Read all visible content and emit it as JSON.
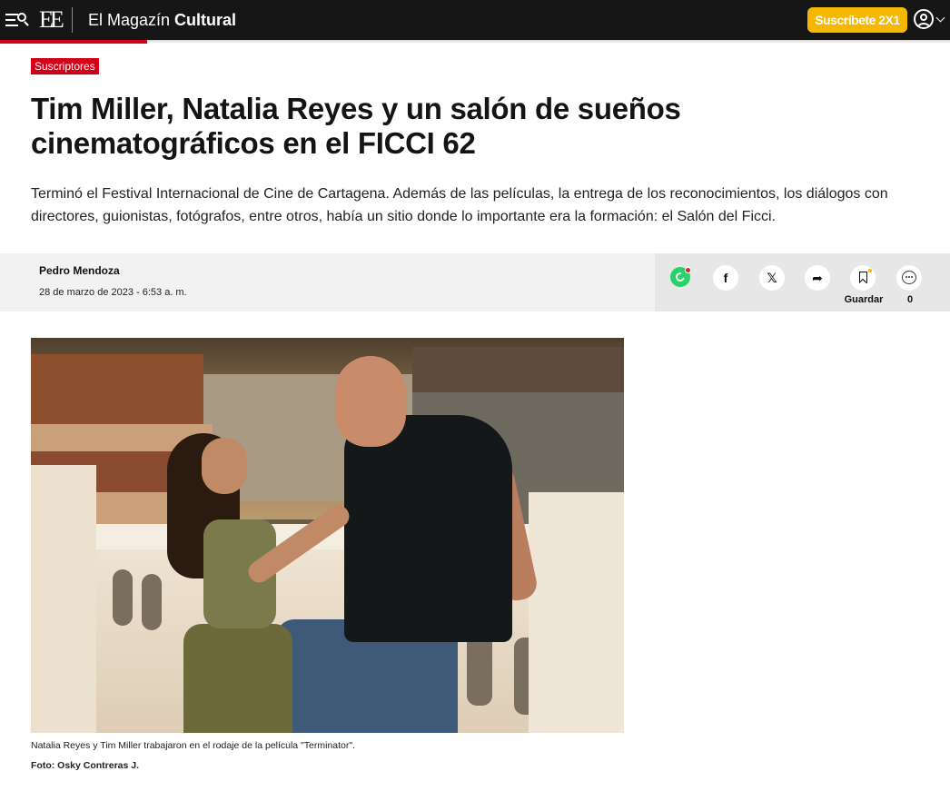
{
  "header": {
    "logo_text": "EE",
    "section_title_light": "El Magazín ",
    "section_title_bold": "Cultural",
    "subscribe_label": "Suscríbete 2X1",
    "colors": {
      "bar_bg": "#161616",
      "progress": "#d10019",
      "subscribe": "#f5b700"
    },
    "icons": {
      "menu": "menu-search-icon",
      "user": "user-circle-icon",
      "dropdown": "chevron-down-icon"
    }
  },
  "article": {
    "badge": "Suscriptores",
    "title": "Tim Miller, Natalia Reyes y un salón de sueños cinematográficos en el FICCI 62",
    "dek": "Terminó el Festival Internacional de Cine de Cartagena. Además de las películas, la entrega de los reconocimientos, los diálogos con directores, guionistas, fotógrafos, entre otros, había un sitio donde lo importante era la formación: el Salón del Ficci.",
    "author": "Pedro Mendoza",
    "date": "28 de marzo de 2023 - 6:53 a. m."
  },
  "share": {
    "icons": [
      "whatsapp-icon",
      "facebook-icon",
      "x-icon",
      "share-icon",
      "bookmark-icon",
      "comment-icon"
    ],
    "facebook_glyph": "f",
    "x_glyph": "𝕏",
    "share_glyph": "➦",
    "save_label": "Guardar",
    "comment_count": "0"
  },
  "media": {
    "caption": "Natalia Reyes y Tim Miller trabajaron en el rodaje de la película \"Terminator\".",
    "credit": "Foto: Osky Contreras J."
  }
}
